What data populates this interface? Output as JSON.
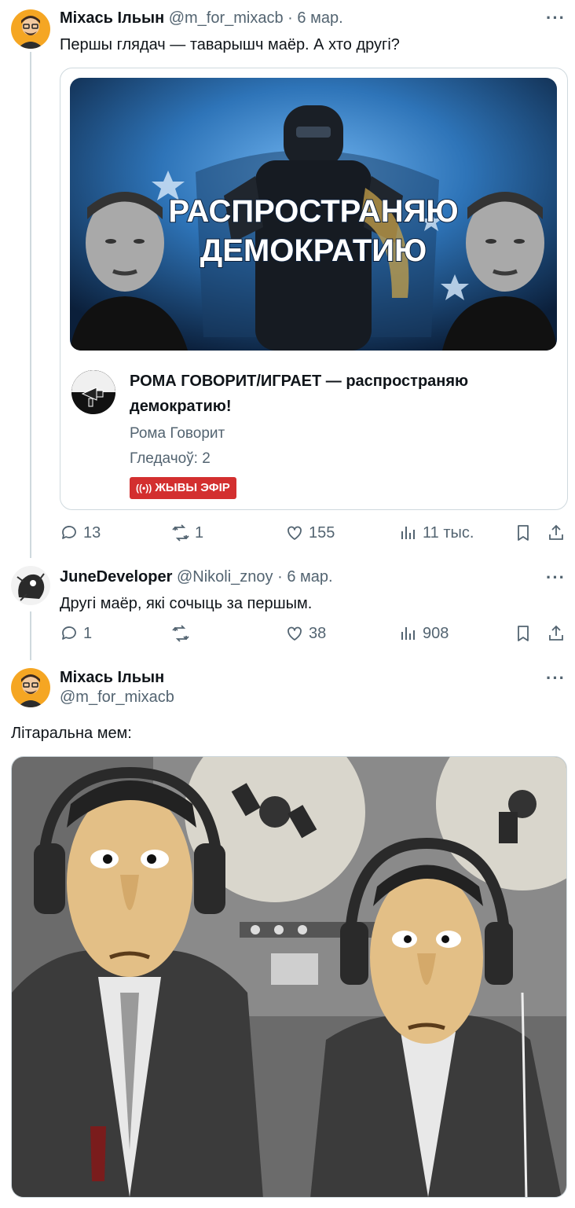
{
  "tweet1": {
    "author_name": "Міхась Ільын",
    "author_handle": "@m_for_mixacb",
    "date": "6 мар.",
    "text": "Першы глядач — таварышч маёр. А хто другі?",
    "card": {
      "thumb_text_line1": "РАСПРОСТРАНЯЮ",
      "thumb_text_line2": "ДЕМОКРАТИЮ",
      "title": "РОМА ГОВОРИТ/ИГРАЕТ — распространяю демократию!",
      "channel": "Рома Говорит",
      "viewers": "Гледачоў: 2",
      "live_label": "ЖЫВЫ ЭФІР",
      "live_color": "#d32f2f"
    },
    "stats": {
      "replies": "13",
      "retweets": "1",
      "likes": "155",
      "views": "11 тыс."
    }
  },
  "tweet2": {
    "author_name": "JuneDeveloper",
    "author_handle": "@Nikoli_znoy",
    "date": "6 мар.",
    "text": "Другі маёр, які сочыць за першым.",
    "stats": {
      "replies": "1",
      "retweets": "",
      "likes": "38",
      "views": "908"
    }
  },
  "tweet3": {
    "author_name": "Міхась Ільын",
    "author_handle": "@m_for_mixacb",
    "text": "Літаральна мем:"
  },
  "meta_separator": " · ",
  "more_label": "···",
  "colors": {
    "secondary_text": "#536471",
    "border": "#cfd9de",
    "text": "#0f1419"
  },
  "icons": [
    "reply-icon",
    "retweet-icon",
    "like-icon",
    "views-icon",
    "bookmark-icon",
    "share-icon",
    "more-icon",
    "broadcast-icon"
  ]
}
